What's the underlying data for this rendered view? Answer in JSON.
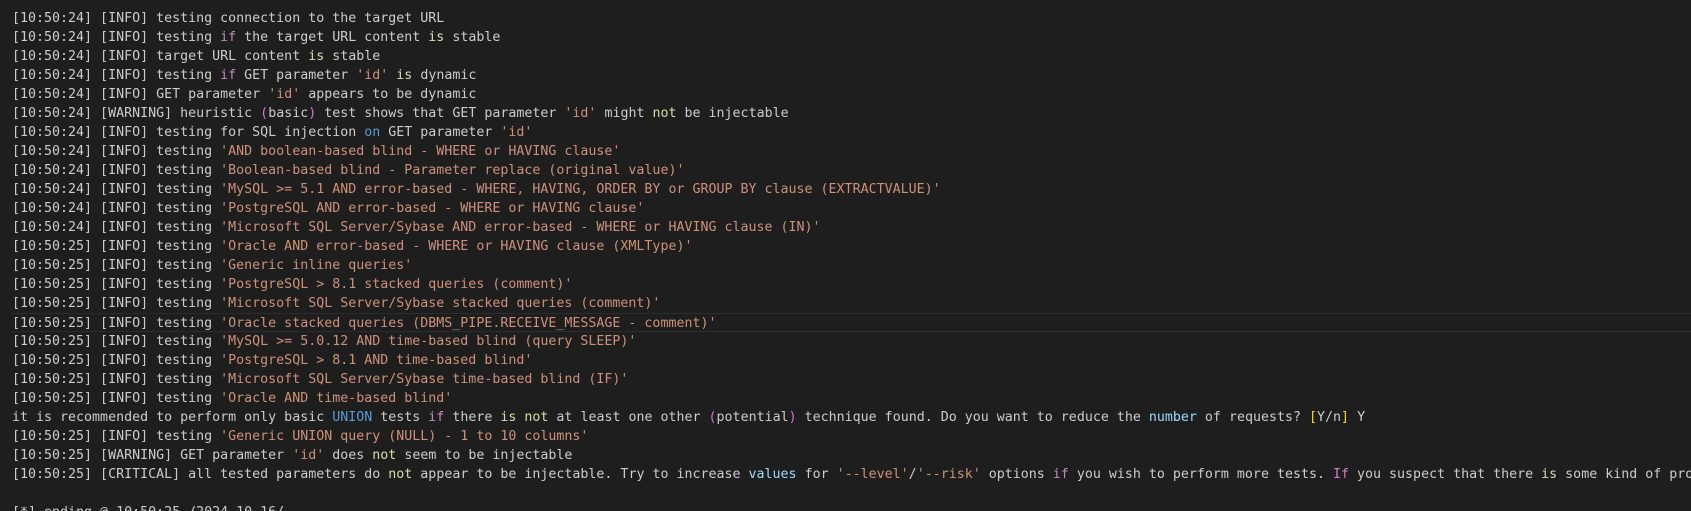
{
  "colors": {
    "background": "#1e1e1e",
    "default": "#cccccc",
    "string": "#ce9178",
    "keyword": "#c586c0",
    "yellow": "#dcdcaa",
    "blue": "#569cd6",
    "light_blue": "#9cdcfe",
    "bracket_magenta": "#da70d6",
    "bracket_gold": "#ffd700"
  },
  "highlighted_line_index": 16,
  "lines": [
    [
      [
        "default",
        "[10:50:24] [INFO] testing connection to the target URL"
      ]
    ],
    [
      [
        "default",
        "[10:50:24] [INFO] testing "
      ],
      [
        "keyword",
        "if"
      ],
      [
        "default",
        " the target URL content "
      ],
      [
        "yellow",
        "is"
      ],
      [
        "default",
        " stable"
      ]
    ],
    [
      [
        "default",
        "[10:50:24] [INFO] target URL content "
      ],
      [
        "yellow",
        "is"
      ],
      [
        "default",
        " stable"
      ]
    ],
    [
      [
        "default",
        "[10:50:24] [INFO] testing "
      ],
      [
        "keyword",
        "if"
      ],
      [
        "default",
        " GET parameter "
      ],
      [
        "string",
        "'id'"
      ],
      [
        "default",
        " "
      ],
      [
        "yellow",
        "is"
      ],
      [
        "default",
        " dynamic"
      ]
    ],
    [
      [
        "default",
        "[10:50:24] [INFO] GET parameter "
      ],
      [
        "string",
        "'id'"
      ],
      [
        "default",
        " appears to be dynamic"
      ]
    ],
    [
      [
        "default",
        "[10:50:24] [WARNING] heuristic "
      ],
      [
        "bracket",
        "("
      ],
      [
        "default",
        "basic"
      ],
      [
        "bracket",
        ")"
      ],
      [
        "default",
        " test shows that GET parameter "
      ],
      [
        "string",
        "'id'"
      ],
      [
        "default",
        " might "
      ],
      [
        "yellow",
        "not"
      ],
      [
        "default",
        " be injectable"
      ]
    ],
    [
      [
        "default",
        "[10:50:24] [INFO] testing for SQL injection "
      ],
      [
        "blue",
        "on"
      ],
      [
        "default",
        " GET parameter "
      ],
      [
        "string",
        "'id'"
      ]
    ],
    [
      [
        "default",
        "[10:50:24] [INFO] testing "
      ],
      [
        "string",
        "'AND boolean-based blind - WHERE or HAVING clause'"
      ]
    ],
    [
      [
        "default",
        "[10:50:24] [INFO] testing "
      ],
      [
        "string",
        "'Boolean-based blind - Parameter replace (original value)'"
      ]
    ],
    [
      [
        "default",
        "[10:50:24] [INFO] testing "
      ],
      [
        "string",
        "'MySQL >= 5.1 AND error-based - WHERE, HAVING, ORDER BY or GROUP BY clause (EXTRACTVALUE)'"
      ]
    ],
    [
      [
        "default",
        "[10:50:24] [INFO] testing "
      ],
      [
        "string",
        "'PostgreSQL AND error-based - WHERE or HAVING clause'"
      ]
    ],
    [
      [
        "default",
        "[10:50:24] [INFO] testing "
      ],
      [
        "string",
        "'Microsoft SQL Server/Sybase AND error-based - WHERE or HAVING clause (IN)'"
      ]
    ],
    [
      [
        "default",
        "[10:50:25] [INFO] testing "
      ],
      [
        "string",
        "'Oracle AND error-based - WHERE or HAVING clause (XMLType)'"
      ]
    ],
    [
      [
        "default",
        "[10:50:25] [INFO] testing "
      ],
      [
        "string",
        "'Generic inline queries'"
      ]
    ],
    [
      [
        "default",
        "[10:50:25] [INFO] testing "
      ],
      [
        "string",
        "'PostgreSQL > 8.1 stacked queries (comment)'"
      ]
    ],
    [
      [
        "default",
        "[10:50:25] [INFO] testing "
      ],
      [
        "string",
        "'Microsoft SQL Server/Sybase stacked queries (comment)'"
      ]
    ],
    [
      [
        "default",
        "[10:50:25] [INFO] testing "
      ],
      [
        "string",
        "'Oracle stacked queries (DBMS_PIPE.RECEIVE_MESSAGE - comment)'"
      ]
    ],
    [
      [
        "default",
        "[10:50:25] [INFO] testing "
      ],
      [
        "string",
        "'MySQL >= 5.0.12 AND time-based blind (query SLEEP)'"
      ]
    ],
    [
      [
        "default",
        "[10:50:25] [INFO] testing "
      ],
      [
        "string",
        "'PostgreSQL > 8.1 AND time-based blind'"
      ]
    ],
    [
      [
        "default",
        "[10:50:25] [INFO] testing "
      ],
      [
        "string",
        "'Microsoft SQL Server/Sybase time-based blind (IF)'"
      ]
    ],
    [
      [
        "default",
        "[10:50:25] [INFO] testing "
      ],
      [
        "string",
        "'Oracle AND time-based blind'"
      ]
    ],
    [
      [
        "default",
        "it is recommended to perform only basic "
      ],
      [
        "blue",
        "UNION"
      ],
      [
        "default",
        " tests "
      ],
      [
        "keyword",
        "if"
      ],
      [
        "default",
        " there "
      ],
      [
        "yellow",
        "is"
      ],
      [
        "default",
        " "
      ],
      [
        "yellow",
        "not"
      ],
      [
        "default",
        " at least one other "
      ],
      [
        "bracket",
        "("
      ],
      [
        "default",
        "potential"
      ],
      [
        "bracket",
        ")"
      ],
      [
        "default",
        " technique found. Do you want to reduce the "
      ],
      [
        "lightblue",
        "number"
      ],
      [
        "default",
        " of requests? "
      ],
      [
        "bracket2",
        "["
      ],
      [
        "default",
        "Y/n"
      ],
      [
        "bracket2",
        "]"
      ],
      [
        "default",
        " Y"
      ]
    ],
    [
      [
        "default",
        "[10:50:25] [INFO] testing "
      ],
      [
        "string",
        "'Generic UNION query (NULL) - 1 to 10 columns'"
      ]
    ],
    [
      [
        "default",
        "[10:50:25] [WARNING] GET parameter "
      ],
      [
        "string",
        "'id'"
      ],
      [
        "default",
        " does "
      ],
      [
        "yellow",
        "not"
      ],
      [
        "default",
        " seem to be injectable"
      ]
    ],
    [
      [
        "default",
        "[10:50:25] [CRITICAL] all tested parameters do "
      ],
      [
        "yellow",
        "not"
      ],
      [
        "default",
        " appear to be injectable. Try to increase "
      ],
      [
        "lightblue",
        "values"
      ],
      [
        "default",
        " for "
      ],
      [
        "string",
        "'--level'"
      ],
      [
        "default",
        "/"
      ],
      [
        "string",
        "'--risk'"
      ],
      [
        "default",
        " options "
      ],
      [
        "keyword",
        "if"
      ],
      [
        "default",
        " you wish to perform more tests. "
      ],
      [
        "keyword",
        "If"
      ],
      [
        "default",
        " you suspect that there "
      ],
      [
        "yellow",
        "is"
      ],
      [
        "default",
        " some kind of protection"
      ]
    ],
    [
      [
        "default",
        ""
      ]
    ],
    [
      [
        "default",
        "[*] ending @ 10:50:25 /2024-10-16/"
      ]
    ]
  ]
}
